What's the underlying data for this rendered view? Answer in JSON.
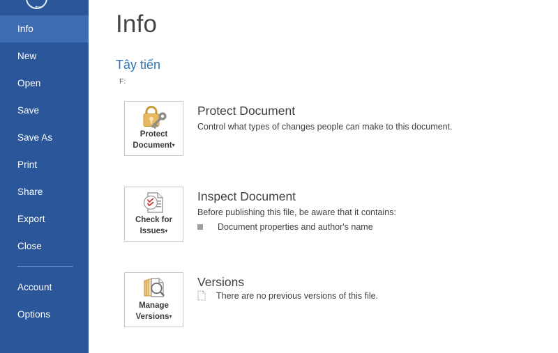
{
  "app": {
    "accent_color": "#2b579a",
    "accent_selected_color": "#3d6cb3",
    "link_color": "#2e75b6"
  },
  "sidebar": {
    "back_button": {
      "name": "back-button",
      "glyph": "←"
    },
    "items": [
      {
        "label": "Info",
        "selected": true
      },
      {
        "label": "New",
        "selected": false
      },
      {
        "label": "Open",
        "selected": false
      },
      {
        "label": "Save",
        "selected": false
      },
      {
        "label": "Save As",
        "selected": false
      },
      {
        "label": "Print",
        "selected": false
      },
      {
        "label": "Share",
        "selected": false
      },
      {
        "label": "Export",
        "selected": false
      },
      {
        "label": "Close",
        "selected": false
      }
    ],
    "footer_items": [
      {
        "label": "Account"
      },
      {
        "label": "Options"
      }
    ]
  },
  "main": {
    "page_title": "Info",
    "document_name": "Tây tiến",
    "document_path": "F:",
    "sections": {
      "protect": {
        "button_label_line1": "Protect",
        "button_label_line2": "Document",
        "button_caret": "▾",
        "heading": "Protect Document",
        "description": "Control what types of changes people can make to this document."
      },
      "inspect": {
        "button_label_line1": "Check for",
        "button_label_line2": "Issues",
        "button_caret": "▾",
        "heading": "Inspect Document",
        "description": "Before publishing this file, be aware that it contains:",
        "detail": "Document properties and author's name"
      },
      "versions": {
        "button_label_line1": "Manage",
        "button_label_line2": "Versions",
        "button_caret": "▾",
        "heading": "Versions",
        "description": "There are no previous versions of this file."
      }
    }
  }
}
